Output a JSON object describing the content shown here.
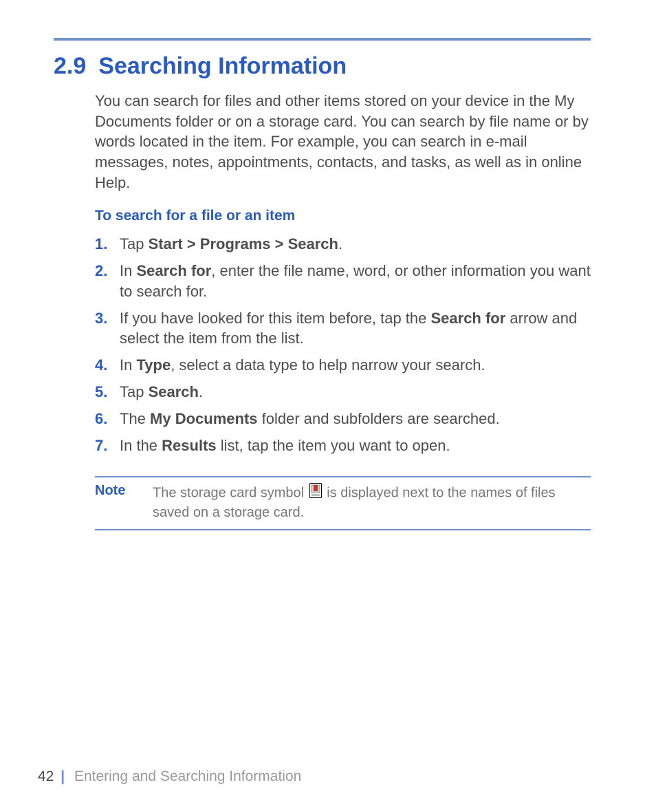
{
  "heading": {
    "number": "2.9",
    "title": "Searching Information"
  },
  "intro": "You can search for files and other items stored on your device in the My Documents folder or on a storage card. You can search by file name or by words located in the item. For example, you can search in e-mail messages, notes, appointments, contacts, and tasks, as well as in online Help.",
  "subheading": "To search for a file or an item",
  "steps": {
    "s1": {
      "pre": "Tap ",
      "b1": "Start > Programs > Search",
      "post": "."
    },
    "s2": {
      "pre": "In ",
      "b1": "Search for",
      "post": ", enter the file name, word, or other information you want to search for."
    },
    "s3": {
      "pre": "If you have looked for this item before, tap the ",
      "b1": "Search for",
      "post": " arrow and select the item from the list."
    },
    "s4": {
      "pre": "In ",
      "b1": "Type",
      "post": ", select a data type to help narrow your search."
    },
    "s5": {
      "pre": "Tap ",
      "b1": "Search",
      "post": "."
    },
    "s6": {
      "pre": "The ",
      "b1": "My Documents",
      "post": " folder and subfolders are searched."
    },
    "s7": {
      "pre": "In the ",
      "b1": "Results",
      "post": " list, tap the item you want to open."
    }
  },
  "note": {
    "label": "Note",
    "before": "The storage card symbol ",
    "after": " is displayed next to the names of files saved on a storage card."
  },
  "footer": {
    "page_number": "42",
    "chapter": "Entering and Searching Information"
  }
}
